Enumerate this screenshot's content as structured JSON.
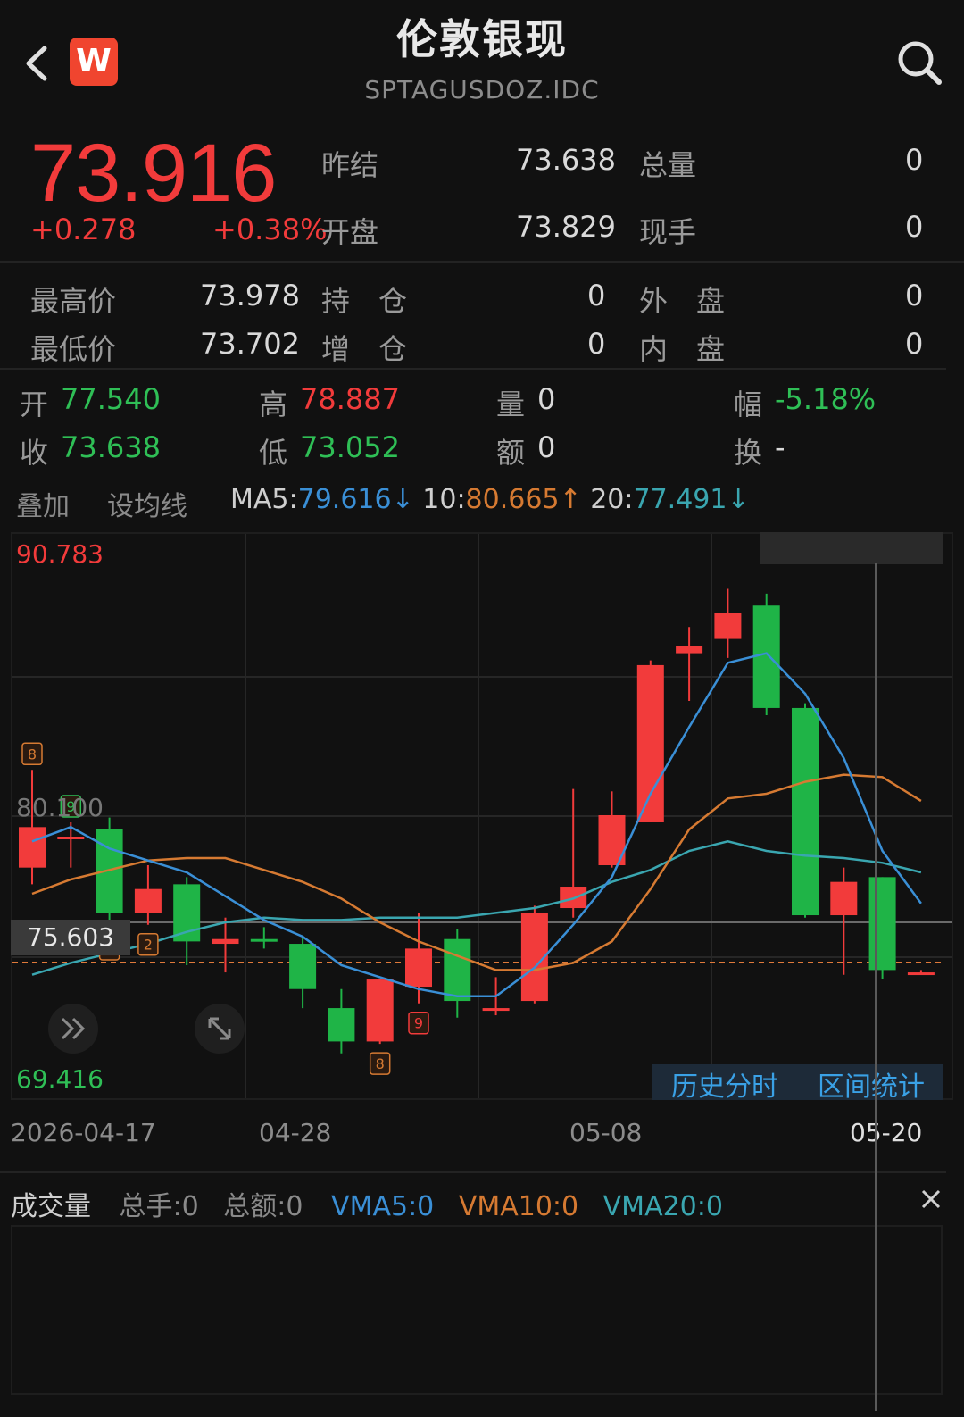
{
  "header": {
    "title": "伦敦银现",
    "code": "SPTAGUSDOZ.IDC",
    "logo_letter": "W"
  },
  "quote": {
    "price": "73.916",
    "change": "+0.278",
    "change_pct": "+0.38%",
    "rows": [
      {
        "label": "昨结",
        "value": "73.638",
        "label2": "总量",
        "value2": "0"
      },
      {
        "label": "开盘",
        "value": "73.829",
        "label2": "现手",
        "value2": "0"
      }
    ],
    "rows2": [
      {
        "label": "最高价",
        "value": "73.978",
        "label2": "持　仓",
        "value2": "0",
        "label3": "外　盘",
        "value3": "0"
      },
      {
        "label": "最低价",
        "value": "73.702",
        "label2": "增　仓",
        "value2": "0",
        "label3": "内　盘",
        "value3": "0"
      }
    ]
  },
  "kline_info": {
    "open_label": "开",
    "open": "77.540",
    "high_label": "高",
    "high": "78.887",
    "vol_label": "量",
    "vol": "0",
    "amp_label": "幅",
    "amp": "-5.18%",
    "close_label": "收",
    "close": "73.638",
    "low_label": "低",
    "low": "73.052",
    "amt_label": "额",
    "amt": "0",
    "turn_label": "换",
    "turn": "-"
  },
  "ma_bar": {
    "overlay": "叠加",
    "set_ma": "设均线",
    "ma5_label": "MA5:",
    "ma5": "79.616↓",
    "ma10_label": "10:",
    "ma10": "80.665↑",
    "ma20_label": "20:",
    "ma20": "77.491↓"
  },
  "chart_labels": {
    "top": "90.783",
    "mid": "80.100",
    "bottom": "69.416",
    "crosshair": "75.603",
    "history_btn": "历史分时",
    "range_btn": "区间统计",
    "dates": [
      "2026-04-17",
      "04-28",
      "05-08",
      "05-20"
    ]
  },
  "volume": {
    "title": "成交量",
    "total_hands": "总手:0",
    "total_amount": "总额:0",
    "vma5": "VMA5:0",
    "vma10": "VMA10:0",
    "vma20": "VMA20:0"
  },
  "colors": {
    "up": "#f23b3b",
    "down": "#1fb447",
    "ma5": "#3a8fd6",
    "ma10": "#d67a32",
    "ma20": "#3aa6b0"
  },
  "chart_data": {
    "type": "candlestick",
    "ylim": [
      69.416,
      90.783
    ],
    "candles": [
      {
        "o": 77.9,
        "c": 79.6,
        "h": 82.0,
        "l": 77.2,
        "up": true
      },
      {
        "o": 79.1,
        "c": 79.2,
        "h": 79.8,
        "l": 77.9,
        "up": true
      },
      {
        "o": 79.5,
        "c": 76.0,
        "h": 80.0,
        "l": 75.3,
        "up": false
      },
      {
        "o": 76.0,
        "c": 77.0,
        "h": 78.0,
        "l": 75.5,
        "up": true
      },
      {
        "o": 77.2,
        "c": 74.8,
        "h": 77.5,
        "l": 73.8,
        "up": false
      },
      {
        "o": 74.7,
        "c": 74.9,
        "h": 75.8,
        "l": 73.5,
        "up": true
      },
      {
        "o": 74.9,
        "c": 74.9,
        "h": 75.4,
        "l": 74.5,
        "up": false
      },
      {
        "o": 74.7,
        "c": 72.8,
        "h": 75.0,
        "l": 72.0,
        "up": false
      },
      {
        "o": 72.0,
        "c": 70.6,
        "h": 72.8,
        "l": 70.1,
        "up": false
      },
      {
        "o": 70.6,
        "c": 73.2,
        "h": 73.2,
        "l": 70.5,
        "up": true
      },
      {
        "o": 72.9,
        "c": 74.5,
        "h": 76.0,
        "l": 72.2,
        "up": true
      },
      {
        "o": 74.9,
        "c": 72.3,
        "h": 75.3,
        "l": 71.6,
        "up": false
      },
      {
        "o": 72.0,
        "c": 72.0,
        "h": 73.3,
        "l": 71.7,
        "up": true
      },
      {
        "o": 72.3,
        "c": 76.0,
        "h": 76.3,
        "l": 72.2,
        "up": true
      },
      {
        "o": 76.2,
        "c": 77.1,
        "h": 81.2,
        "l": 75.8,
        "up": true
      },
      {
        "o": 78.0,
        "c": 80.1,
        "h": 81.1,
        "l": 77.9,
        "up": true
      },
      {
        "o": 79.8,
        "c": 86.4,
        "h": 86.6,
        "l": 79.8,
        "up": true
      },
      {
        "o": 86.9,
        "c": 87.2,
        "h": 88.0,
        "l": 84.9,
        "up": true
      },
      {
        "o": 87.5,
        "c": 88.6,
        "h": 89.6,
        "l": 86.7,
        "up": true
      },
      {
        "o": 88.9,
        "c": 84.6,
        "h": 89.4,
        "l": 84.3,
        "up": false
      },
      {
        "o": 84.6,
        "c": 75.9,
        "h": 84.8,
        "l": 75.8,
        "up": false
      },
      {
        "o": 77.3,
        "c": 75.9,
        "h": 77.9,
        "l": 73.4,
        "up": true
      },
      {
        "o": 77.5,
        "c": 73.6,
        "h": 77.5,
        "l": 73.2,
        "up": false
      },
      {
        "o": 73.5,
        "c": 73.5,
        "h": 73.6,
        "l": 73.4,
        "up": true
      }
    ],
    "ma5": [
      79.0,
      79.6,
      78.7,
      78.2,
      77.7,
      76.7,
      75.7,
      75.0,
      73.8,
      73.3,
      72.8,
      72.5,
      72.5,
      73.7,
      75.5,
      77.5,
      81.0,
      83.8,
      86.5,
      86.9,
      85.2,
      82.5,
      78.6,
      76.4
    ],
    "ma10": [
      76.8,
      77.4,
      77.8,
      78.2,
      78.3,
      78.3,
      77.8,
      77.3,
      76.6,
      75.6,
      74.8,
      74.2,
      73.6,
      73.6,
      73.9,
      74.8,
      77.0,
      79.5,
      80.8,
      81.0,
      81.5,
      81.8,
      81.7,
      80.7
    ],
    "ma20": [
      73.4,
      73.9,
      74.3,
      74.7,
      75.2,
      75.6,
      75.8,
      75.7,
      75.7,
      75.8,
      75.8,
      75.8,
      76.0,
      76.2,
      76.6,
      77.3,
      77.8,
      78.6,
      79.0,
      78.6,
      78.4,
      78.3,
      78.1,
      77.7
    ],
    "crosshair_price": 75.603,
    "dashed_price": 73.916,
    "markers": [
      {
        "i": 0,
        "text": "8",
        "color": "#d67a32",
        "above": true
      },
      {
        "i": 1,
        "text": "9",
        "color": "#2fbf56",
        "above": true
      },
      {
        "i": 2,
        "text": "1",
        "color": "#d67a32",
        "above": false
      },
      {
        "i": 3,
        "text": "2",
        "color": "#d67a32",
        "above": false
      },
      {
        "i": 10,
        "text": "9",
        "color": "#f23b3b",
        "above": false
      },
      {
        "i": 9,
        "text": "8",
        "color": "#d67a32",
        "above": false
      }
    ]
  }
}
